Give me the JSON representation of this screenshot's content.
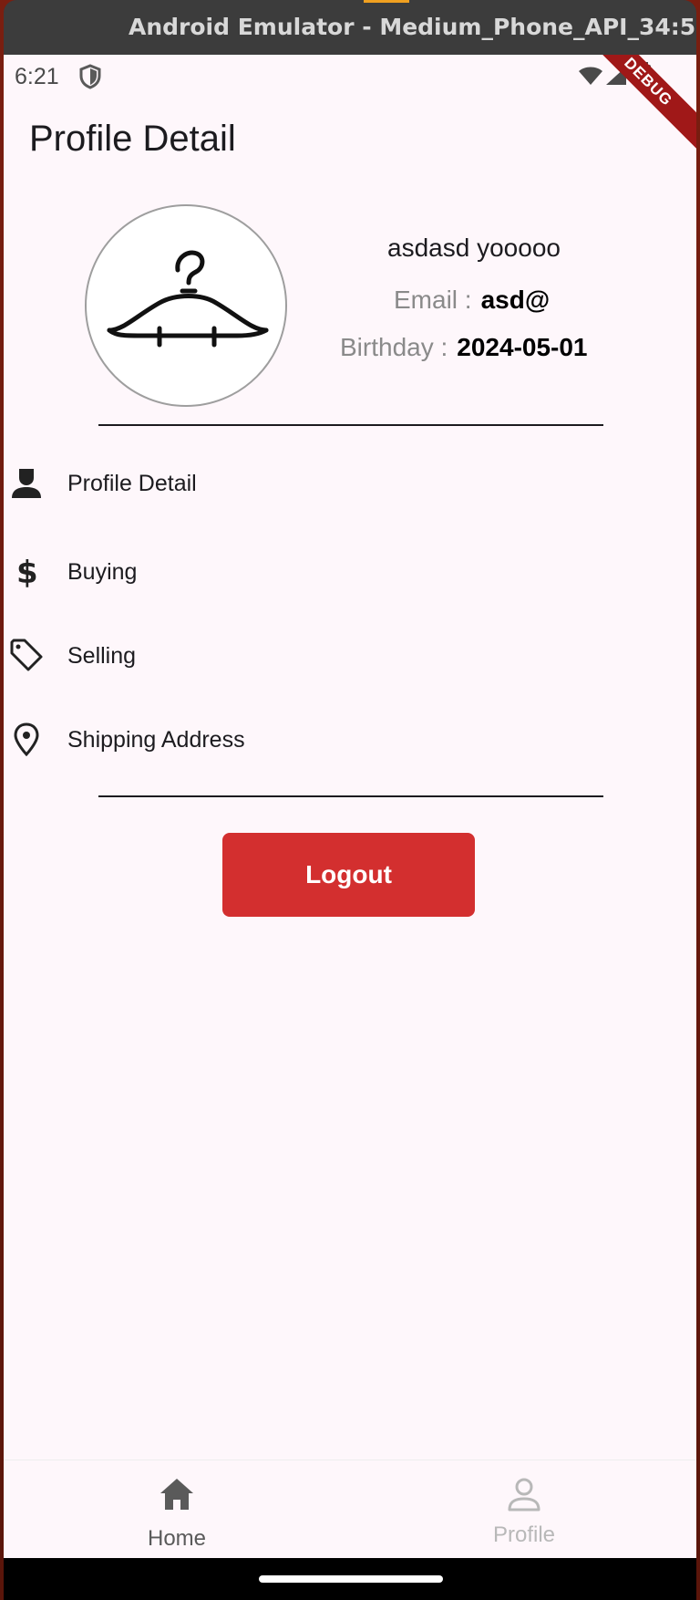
{
  "window": {
    "title": "Android Emulator - Medium_Phone_API_34:5..."
  },
  "status_bar": {
    "time": "6:21",
    "debug_label": "DEBUG"
  },
  "page": {
    "title": "Profile Detail"
  },
  "profile": {
    "name": "asdasd yooooo",
    "email_label": "Email :",
    "email_value": "asd@",
    "birthday_label": "Birthday :",
    "birthday_value": "2024-05-01"
  },
  "menu": [
    {
      "label": "Profile Detail",
      "icon": "person-icon"
    },
    {
      "label": "Buying",
      "icon": "dollar-icon"
    },
    {
      "label": "Selling",
      "icon": "tag-icon"
    },
    {
      "label": "Shipping Address",
      "icon": "location-pin-icon"
    }
  ],
  "logout": {
    "label": "Logout",
    "color": "#d32f2f"
  },
  "bottom_nav": {
    "items": [
      {
        "label": "Home",
        "icon": "home-icon",
        "selected": true
      },
      {
        "label": "Profile",
        "icon": "profile-icon",
        "selected": false
      }
    ]
  }
}
